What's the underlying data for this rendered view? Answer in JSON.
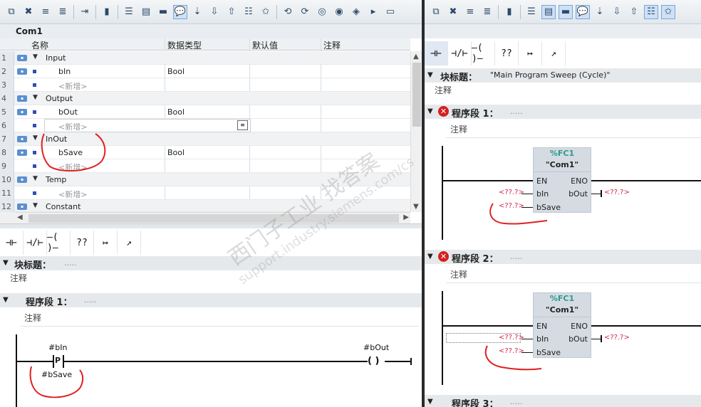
{
  "block": {
    "name": "Com1"
  },
  "columns": {
    "name": "名称",
    "type": "数据类型",
    "default": "默认值",
    "comment": "注释"
  },
  "rows": [
    {
      "num": "1",
      "name": "Input",
      "type": ""
    },
    {
      "num": "2",
      "name": "bIn",
      "type": "Bool"
    },
    {
      "num": "3",
      "name": "<新增>",
      "type": ""
    },
    {
      "num": "4",
      "name": "Output",
      "type": ""
    },
    {
      "num": "5",
      "name": "bOut",
      "type": "Bool"
    },
    {
      "num": "6",
      "name": "<新增>",
      "type": ""
    },
    {
      "num": "7",
      "name": "InOut",
      "type": ""
    },
    {
      "num": "8",
      "name": "bSave",
      "type": "Bool"
    },
    {
      "num": "9",
      "name": "<新增>",
      "type": ""
    },
    {
      "num": "10",
      "name": "Temp",
      "type": ""
    },
    {
      "num": "11",
      "name": "<新增>",
      "type": ""
    },
    {
      "num": "12",
      "name": "Constant",
      "type": ""
    }
  ],
  "left_editor": {
    "block_title_label": "块标题：",
    "block_title_dots": ".....",
    "block_comment": "注释",
    "network1_label": "程序段 1：",
    "network1_dots": ".....",
    "network1_comment": "注释",
    "contact_top": "#bIn",
    "contact_mid": "P",
    "contact_bottom": "#bSave",
    "coil_top": "#bOut",
    "coil_symbol": "( )"
  },
  "right_editor": {
    "block_title_label": "块标题：",
    "block_title_value": "\"Main Program Sweep (Cycle)\"",
    "block_comment": "注释",
    "network1_label": "程序段 1：",
    "network1_dots": ".....",
    "network1_comment": "注释",
    "network2_label": "程序段 2：",
    "network2_dots": ".....",
    "network2_comment": "注释",
    "network3_label": "程序段 3：",
    "network3_dots": ".....",
    "fc_number": "%FC1",
    "fc_name": "\"Com1\"",
    "pin_en": "EN",
    "pin_eno": "ENO",
    "pin_bin": "bIn",
    "pin_bout": "bOut",
    "pin_bsave": "bSave",
    "placeholder": "<??.?>"
  },
  "lad_elements": [
    "⊣⊢",
    "⊣/⊢",
    "–( )–",
    "??",
    "↦",
    "↗"
  ],
  "watermark": {
    "cn": "西门子工业 找答案",
    "url": "support.industry.siemens.com/cs"
  },
  "colors": {
    "accent": "#2a9b8e",
    "error": "#d42020",
    "placeholder": "#d0254a",
    "annotation": "#e02020"
  }
}
